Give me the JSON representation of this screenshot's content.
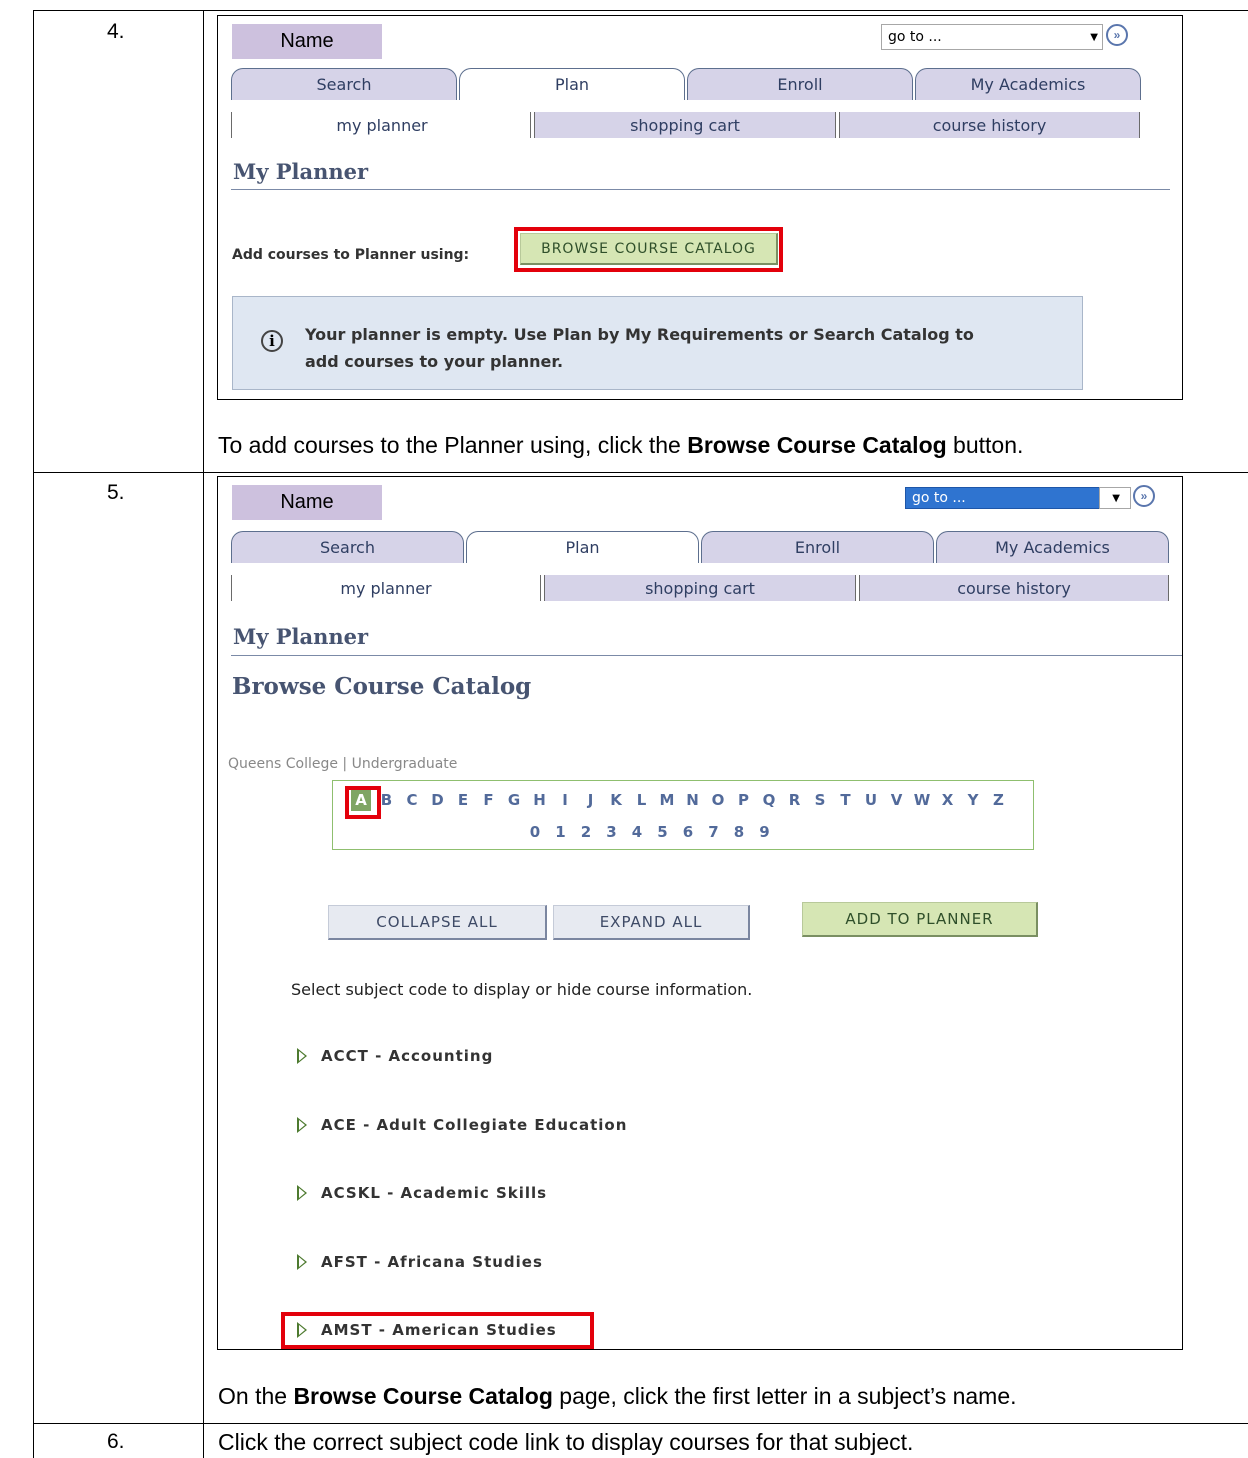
{
  "steps": [
    {
      "number": "4.",
      "caption_pre": "To add courses to the Planner using, click the ",
      "caption_bold": "Browse Course Catalog",
      "caption_post": " button."
    },
    {
      "number": "5.",
      "caption_pre": "On the ",
      "caption_bold": "Browse Course Catalog",
      "caption_post": " page, click the first letter in a subject’s name."
    },
    {
      "number": "6.",
      "caption": "Click the correct subject code link to display courses for that subject."
    }
  ],
  "screen": {
    "name_label": "Name",
    "goto_placeholder": "go to ...",
    "tabs": [
      "Search",
      "Plan",
      "Enroll",
      "My Academics"
    ],
    "subtabs": [
      "my planner",
      "shopping cart",
      "course history"
    ],
    "page_title": "My Planner"
  },
  "planner_empty": {
    "add_label": "Add courses to Planner using:",
    "browse_button": "Browse Course Catalog",
    "info_line1": "Your planner is empty.  Use Plan by My Requirements or Search Catalog to",
    "info_line2": "add courses to your planner."
  },
  "catalog": {
    "heading": "Browse Course Catalog",
    "breadcrumb": "Queens College | Undergraduate",
    "letters": [
      "A",
      "B",
      "C",
      "D",
      "E",
      "F",
      "G",
      "H",
      "I",
      "J",
      "K",
      "L",
      "M",
      "N",
      "O",
      "P",
      "Q",
      "R",
      "S",
      "T",
      "U",
      "V",
      "W",
      "X",
      "Y",
      "Z"
    ],
    "digits": [
      "0",
      "1",
      "2",
      "3",
      "4",
      "5",
      "6",
      "7",
      "8",
      "9"
    ],
    "selected_letter": "A",
    "collapse_all": "Collapse All",
    "expand_all": "Expand All",
    "add_to_planner": "Add To Planner",
    "help_text": "Select subject code to display or hide course information.",
    "subjects": [
      "ACCT - Accounting",
      "ACE - Adult Collegiate Education",
      "ACSKL - Academic Skills",
      "AFST - Africana Studies",
      "AMST - American Studies"
    ]
  },
  "colors": {
    "highlight": "#e3000b",
    "green_button": "#d6e6b4",
    "tab_bg": "#d6d3e8",
    "name_bg": "#cdc1de"
  }
}
